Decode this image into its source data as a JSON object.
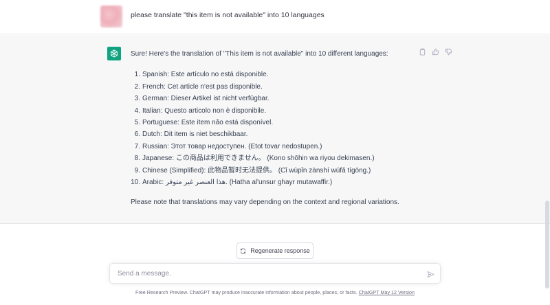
{
  "user_message": {
    "text": "please translate \"this item is not available\" into 10 languages"
  },
  "assistant_message": {
    "intro": "Sure! Here's the translation of \"This item is not available\" into 10 different languages:",
    "translations": [
      {
        "number": "1.",
        "text": "Spanish: Este artículo no está disponible."
      },
      {
        "number": "2.",
        "text": "French: Cet article n'est pas disponible."
      },
      {
        "number": "3.",
        "text": "German: Dieser Artikel ist nicht verfügbar."
      },
      {
        "number": "4.",
        "text": "Italian: Questo articolo non è disponibile."
      },
      {
        "number": "5.",
        "text": "Portuguese: Este item não está disponível."
      },
      {
        "number": "6.",
        "text": "Dutch: Dit item is niet beschikbaar."
      },
      {
        "number": "7.",
        "text": "Russian: Этот товар недоступен. (Etot tovar nedostupen.)"
      },
      {
        "number": "8.",
        "text": "Japanese: この商品は利用できません。 (Kono shōhin wa riyou dekimasen.)"
      },
      {
        "number": "9.",
        "text": "Chinese (Simplified): 此物品暂时无法提供。 (Cǐ wùpǐn zànshí wúfǎ tígōng.)"
      },
      {
        "number": "10.",
        "text": "Arabic: هذا العنصر غير متوفر. (Hatha al'unsur ghayr mutawaffir.)"
      }
    ],
    "note": "Please note that translations may vary depending on the context and regional variations.",
    "actions": [
      "copy-icon",
      "thumbs-up-icon",
      "thumbs-down-icon"
    ]
  },
  "regenerate": {
    "label": "Regenerate response",
    "icon": "refresh-icon"
  },
  "composer": {
    "placeholder": "Send a message.",
    "value": "",
    "send_icon": "send-icon"
  },
  "footer": {
    "text": "Free Research Preview. ChatGPT may produce inaccurate information about people, places, or facts. ",
    "link": "ChatGPT May 12 Version"
  },
  "colors": {
    "brand": "#10a37f",
    "assistant_bg": "#f7f7f8",
    "text": "#374151"
  }
}
